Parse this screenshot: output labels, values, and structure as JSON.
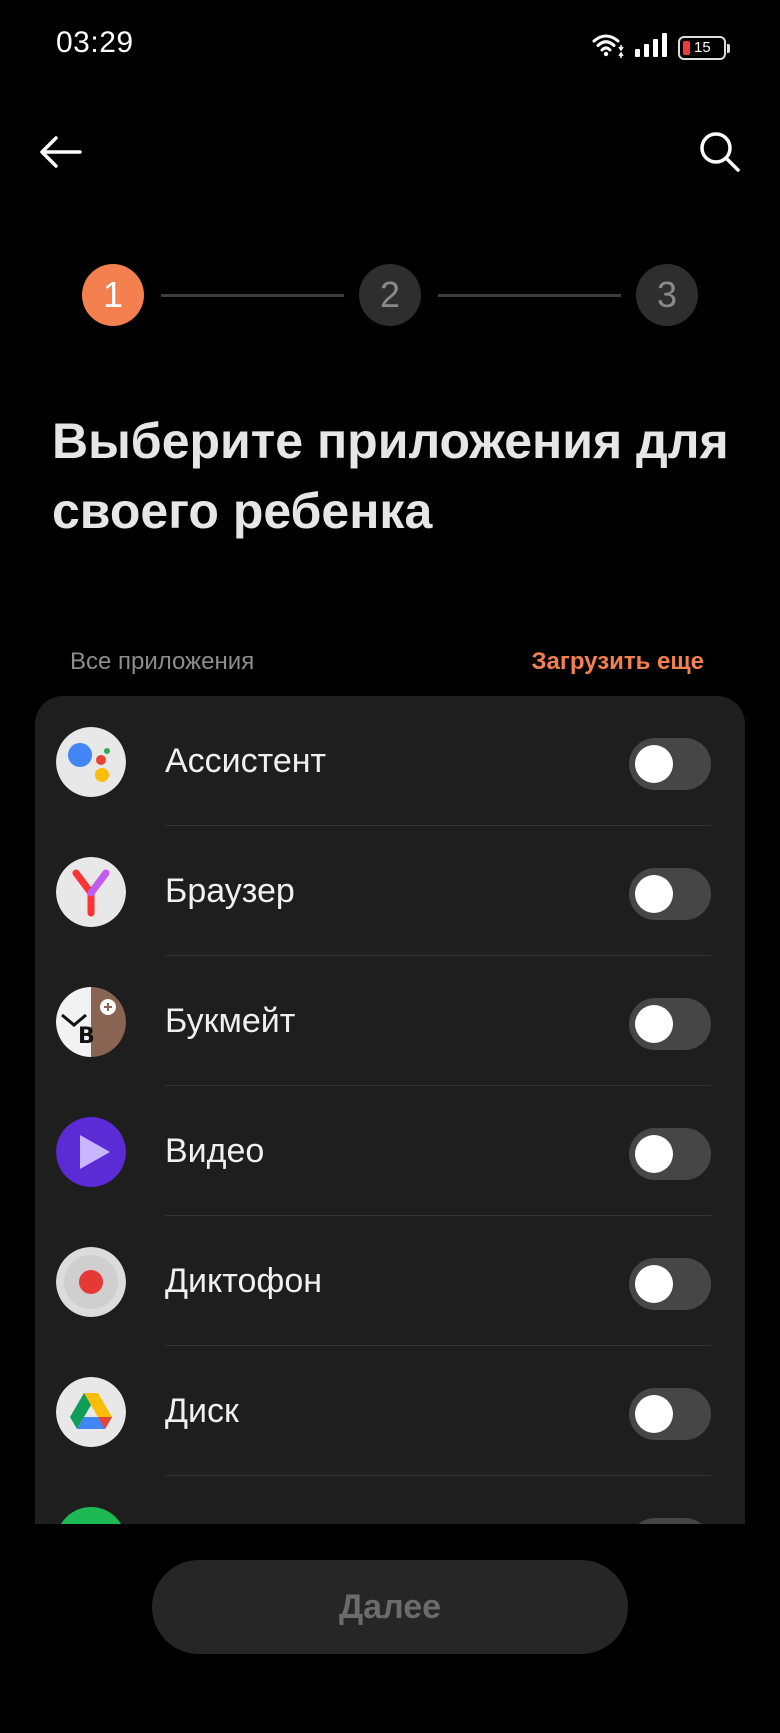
{
  "status_bar": {
    "time": "03:29",
    "battery_level": "15",
    "icons": [
      "wifi-icon",
      "signal-icon",
      "battery-icon"
    ]
  },
  "top_bar": {
    "icons": [
      "back-arrow-icon",
      "search-icon"
    ]
  },
  "stepper": {
    "steps": [
      "1",
      "2",
      "3"
    ],
    "active_step": 1,
    "active_color": "#f4804f"
  },
  "page": {
    "title": "Выберите приложения для своего ребенка"
  },
  "section": {
    "label": "Все приложения",
    "load_more": "Загрузить еще"
  },
  "apps": [
    {
      "name": "Ассистент",
      "icon": "assistant-icon",
      "enabled": false
    },
    {
      "name": "Браузер",
      "icon": "yandex-browser-icon",
      "enabled": false
    },
    {
      "name": "Букмейт",
      "icon": "bookmate-icon",
      "enabled": false
    },
    {
      "name": "Видео",
      "icon": "video-icon",
      "enabled": false
    },
    {
      "name": "Диктофон",
      "icon": "recorder-icon",
      "enabled": false
    },
    {
      "name": "Диск",
      "icon": "drive-icon",
      "enabled": false
    }
  ],
  "footer": {
    "next_label": "Далее"
  },
  "colors": {
    "accent": "#f4804f",
    "background": "#000000",
    "card": "#1e1e1e"
  }
}
